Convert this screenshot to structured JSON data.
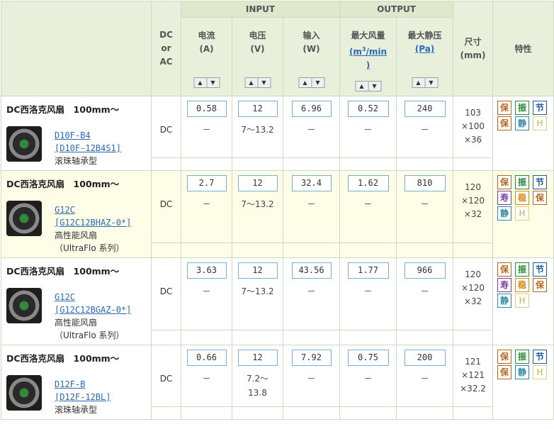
{
  "header": {
    "dc_or_ac": "DC\nor\nAC",
    "input_group": "INPUT",
    "output_group": "OUTPUT",
    "current": "电流\n(A)",
    "voltage": "电压\n(V)",
    "power": "输入\n(W)",
    "airflow_label": "最大风量",
    "airflow_unit_prefix": "(m",
    "airflow_unit_sup": "3",
    "airflow_unit_suffix": "/min\n)",
    "static_pressure": "最大静压",
    "static_pressure_unit": "(Pa)",
    "size": "尺寸\n(mm)",
    "features": "特性"
  },
  "rows": [
    {
      "title": "DC西洛克风扇　100mm～",
      "model": "D10F-B4",
      "part": "[D10F-12B4S1]",
      "desc1": "滚珠轴承型",
      "desc2": "",
      "dcac": "DC",
      "current": "0.58",
      "current_range": "－",
      "voltage": "12",
      "voltage_range": "7～13.2",
      "power": "6.96",
      "power_range": "－",
      "airflow": "0.52",
      "airflow_range": "－",
      "pressure": "240",
      "pressure_range": "－",
      "dims": "103\n×100\n×36",
      "badges": [
        "保",
        "振",
        "节",
        "保",
        "静",
        "H"
      ]
    },
    {
      "title": "DC西洛克风扇　100mm～",
      "model": "G12C",
      "part": "[G12C12BHAZ-0*]",
      "desc1": "高性能风扇",
      "desc2": "（UltraFlo 系列）",
      "dcac": "DC",
      "current": "2.7",
      "current_range": "－",
      "voltage": "12",
      "voltage_range": "7～13.2",
      "power": "32.4",
      "power_range": "－",
      "airflow": "1.62",
      "airflow_range": "－",
      "pressure": "810",
      "pressure_range": "－",
      "dims": "120\n×120\n×32",
      "badges": [
        "保",
        "振",
        "节",
        "寿",
        "稳",
        "保",
        "静",
        "H"
      ]
    },
    {
      "title": "DC西洛克风扇　100mm～",
      "model": "G12C",
      "part": "[G12C12BGAZ-0*]",
      "desc1": "高性能风扇",
      "desc2": "（UltraFlo 系列）",
      "dcac": "DC",
      "current": "3.63",
      "current_range": "－",
      "voltage": "12",
      "voltage_range": "7～13.2",
      "power": "43.56",
      "power_range": "－",
      "airflow": "1.77",
      "airflow_range": "－",
      "pressure": "966",
      "pressure_range": "－",
      "dims": "120\n×120\n×32",
      "badges": [
        "保",
        "振",
        "节",
        "寿",
        "稳",
        "保",
        "静",
        "H"
      ]
    },
    {
      "title": "DC西洛克风扇　100mm～",
      "model": "D12F-B",
      "part": "[D12F-12BL]",
      "desc1": "滚珠轴承型",
      "desc2": "",
      "dcac": "DC",
      "current": "0.66",
      "current_range": "－",
      "voltage": "12",
      "voltage_range": "7.2～\n13.8",
      "power": "7.92",
      "power_range": "－",
      "airflow": "0.75",
      "airflow_range": "－",
      "pressure": "200",
      "pressure_range": "－",
      "dims": "121\n×121\n×32.2",
      "badges": [
        "保",
        "振",
        "节",
        "保",
        "静",
        "H"
      ]
    }
  ]
}
